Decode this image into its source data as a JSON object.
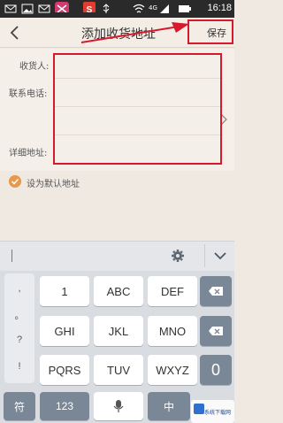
{
  "status_bar": {
    "time": "16:18",
    "signal_label": "4G"
  },
  "nav": {
    "title": "添加收货地址",
    "save_label": "保存"
  },
  "form": {
    "recipient_label": "收货人:",
    "phone_label": "联系电话:",
    "address_label": "详细地址:",
    "recipient_value": "",
    "phone_value": "",
    "address_value": ""
  },
  "default_option": {
    "label": "设为默认地址",
    "checked": true
  },
  "keyboard": {
    "symbols": [
      ",",
      "。",
      "?",
      "!"
    ],
    "row1": [
      {
        "main": "1",
        "sub": ""
      },
      {
        "main": "ABC",
        "sub": ""
      },
      {
        "main": "DEF",
        "sub": ""
      }
    ],
    "row2": [
      {
        "main": "GHI",
        "sub": ""
      },
      {
        "main": "JKL",
        "sub": ""
      },
      {
        "main": "MNO",
        "sub": ""
      }
    ],
    "row3": [
      {
        "main": "PQRS",
        "sub": ""
      },
      {
        "main": "TUV",
        "sub": ""
      },
      {
        "main": "WXYZ",
        "sub": ""
      }
    ],
    "zero_key": "0",
    "bottom": {
      "symbol_key": "符",
      "number_key": "123",
      "lang_key": "中"
    }
  },
  "watermark": "系统下载网",
  "colors": {
    "highlight": "#d6192b",
    "accent": "#e69a4e",
    "key_dark": "#7a8797",
    "key_blue": "#4a86c5"
  }
}
